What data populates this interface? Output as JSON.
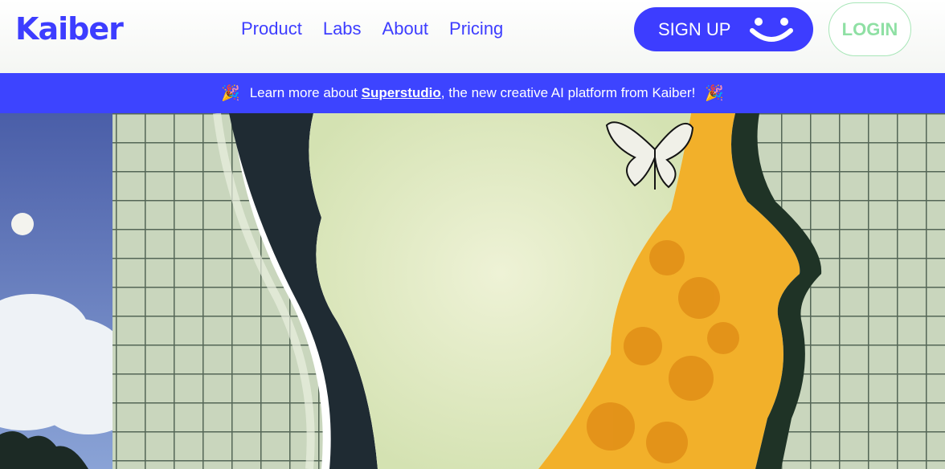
{
  "brand": {
    "name": "Kaiber",
    "color": "#3d3dff"
  },
  "nav": {
    "links": [
      {
        "label": "Product"
      },
      {
        "label": "Labs"
      },
      {
        "label": "About"
      },
      {
        "label": "Pricing"
      }
    ],
    "signup_label": "SIGN UP",
    "signup_icon": "smile-icon",
    "login_label": "LOGIN"
  },
  "banner": {
    "prefix": "Learn more about ",
    "link_label": "Superstudio",
    "suffix": ", the new creative AI platform from Kaiber!",
    "icon": "party-popper-icon",
    "color": "#3d44ff"
  },
  "hero": {
    "image": "surreal-collage-artwork"
  }
}
